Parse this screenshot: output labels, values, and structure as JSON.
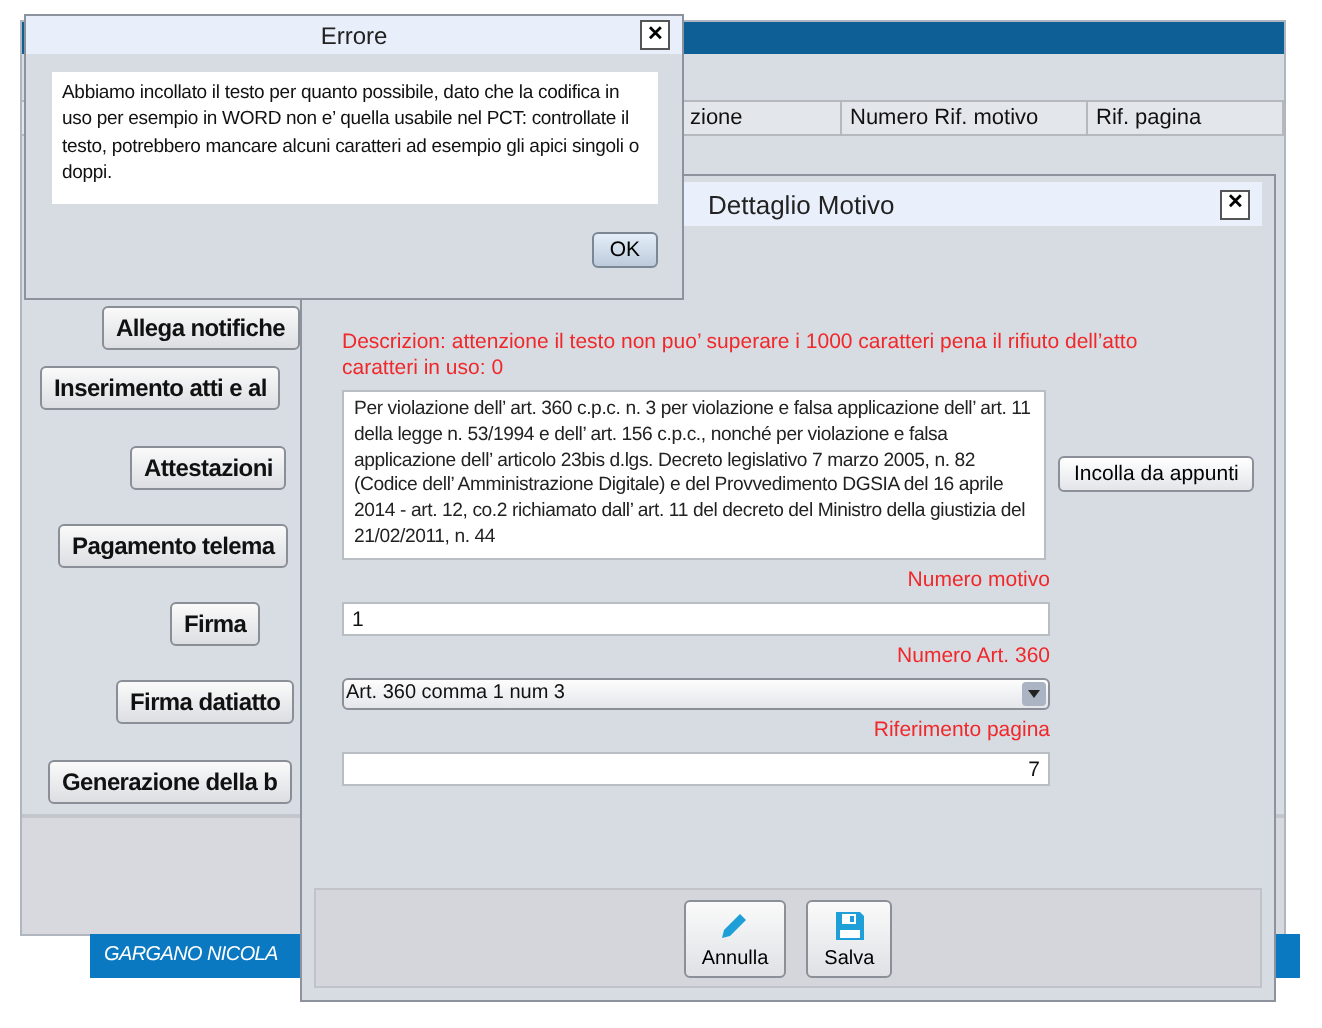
{
  "main_window": {
    "table_columns": [
      "zione",
      "Numero Rif. motivo",
      "Rif. pagina"
    ],
    "buttons": [
      "Allega notifiche",
      "Inserimento atti e al",
      "Attestazioni",
      "Pagamento telema",
      "Firma",
      "Firma datiatto",
      "Generazione della b"
    ],
    "user_name": "GARGANO NICOLA"
  },
  "detail_dialog": {
    "title": "Dettaglio Motivo",
    "close": "✕",
    "warning": "Descrizion: attenzione il testo non puo’ superare i 1000 caratteri pena il rifiuto dell’atto",
    "char_count": "caratteri in uso: 0",
    "description": "Per violazione dell’ art. 360 c.p.c. n. 3 per violazione e falsa applicazione dell’ art. 11 della legge n. 53/1994 e dell’ art. 156 c.p.c., nonché per violazione e falsa applicazione dell’ articolo 23bis d.lgs. Decreto legislativo 7 marzo 2005, n. 82 (Codice dell’ Amministrazione Digitale) e del Provvedimento DGSIA del 16 aprile 2014 -  art. 12, co.2 richiamato dall’ art. 11 del decreto del Ministro della giustizia del 21/02/2011, n. 44",
    "paste_button": "Incolla da appunti",
    "fields": [
      {
        "kind": "text",
        "label": "Numero motivo",
        "value": "1"
      },
      {
        "kind": "select",
        "label": "Numero Art. 360",
        "value": "Art. 360 comma 1 num 3"
      },
      {
        "kind": "number",
        "label": "Riferimento pagina",
        "value": "7"
      }
    ],
    "actions": [
      {
        "kind": "cancel",
        "label": "Annulla"
      },
      {
        "kind": "save",
        "label": "Salva"
      }
    ]
  },
  "error_dialog": {
    "title": "Errore",
    "close": "✕",
    "message": "Abbiamo incollato il testo per quanto possibile, dato che la codifica in uso per esempio in WORD non e’ quella usabile nel PCT: controllate il testo, potrebbero mancare alcuni caratteri ad esempio gli apici singoli o doppi.",
    "ok": "OK"
  }
}
